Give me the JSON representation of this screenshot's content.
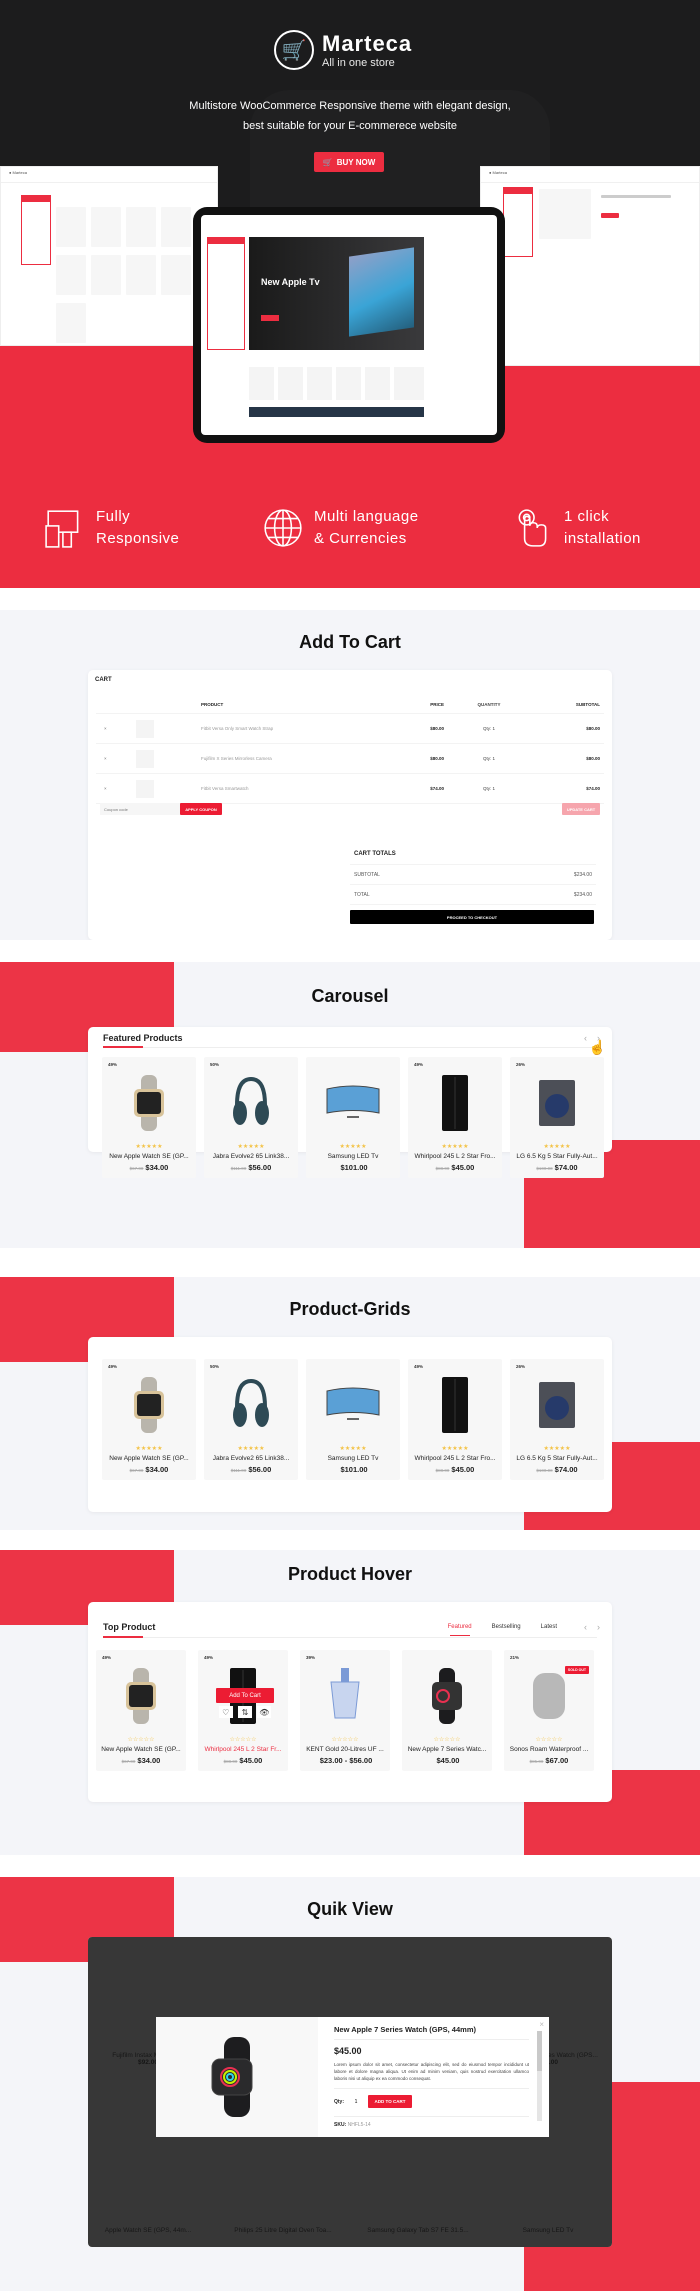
{
  "hero": {
    "brand": "Marteca",
    "tagline": "All in one store",
    "description_line1": "Multistore WooCommerce Responsive theme with elegant design,",
    "description_line2": "best suitable for your E-commerece website",
    "buy_label": "BUY NOW",
    "tablet_banner_title": "New Apple Tv",
    "accent_color": "#ec2d40",
    "features": [
      {
        "icon": "responsive-devices-icon",
        "line1": "Fully",
        "line2": "Responsive"
      },
      {
        "icon": "globe-icon",
        "line1": "Multi language",
        "line2": "& Currencies"
      },
      {
        "icon": "tap-finger-icon",
        "line1": "1 click",
        "line2": "installation"
      }
    ]
  },
  "cart_section": {
    "heading": "Add To Cart",
    "cart_label": "CART",
    "columns": [
      "PRODUCT",
      "PRICE",
      "QUANTITY",
      "SUBTOTAL"
    ],
    "rows": [
      {
        "name": "Fitbit Versa Only Smart Watch Strap",
        "price": "$80.00",
        "qty_label": "Qty:",
        "qty": "1",
        "subtotal": "$80.00"
      },
      {
        "name": "Fujifilm X Series Mirrorless Camera",
        "price": "$80.00",
        "qty_label": "Qty:",
        "qty": "1",
        "subtotal": "$80.00"
      },
      {
        "name": "Fitbit Versa Smartwatch",
        "price": "$74.00",
        "qty_label": "Qty:",
        "qty": "1",
        "subtotal": "$74.00"
      }
    ],
    "coupon_placeholder": "Coupon code",
    "apply_coupon": "APPLY COUPON",
    "update_cart": "UPDATE CART",
    "totals_title": "CART TOTALS",
    "subtotal_label": "SUBTOTAL",
    "subtotal_value": "$234.00",
    "total_label": "TOTAL",
    "total_value": "$234.00",
    "checkout": "PROCEED TO CHECKOUT"
  },
  "carousel_section": {
    "heading": "Carousel",
    "title": "Featured Products",
    "products": [
      {
        "discount": "49%",
        "name": "New Apple Watch SE (GP...",
        "old_price": "$67.00",
        "price": "$34.00",
        "stars": "★★★★★"
      },
      {
        "discount": "50%",
        "name": "Jabra Evolve2 65 Link38...",
        "old_price": "$111.00",
        "price": "$56.00",
        "stars": "★★★★★"
      },
      {
        "discount": "",
        "name": "Samsung LED Tv",
        "old_price": "",
        "price": "$101.00",
        "stars": "★★★★★"
      },
      {
        "discount": "49%",
        "name": "Whirlpool 245 L 2 Star Fro...",
        "old_price": "$88.00",
        "price": "$45.00",
        "stars": "★★★★★"
      },
      {
        "discount": "26%",
        "name": "LG 6.5 Kg 5 Star Fully-Aut...",
        "old_price": "$100.00",
        "price": "$74.00",
        "stars": "★★★★★"
      }
    ]
  },
  "grid_section": {
    "heading": "Product-Grids",
    "products": [
      {
        "discount": "49%",
        "name": "New Apple Watch SE (GP...",
        "old_price": "$67.00",
        "price": "$34.00",
        "stars": "★★★★★"
      },
      {
        "discount": "50%",
        "name": "Jabra Evolve2 65 Link38...",
        "old_price": "$111.00",
        "price": "$56.00",
        "stars": "★★★★★"
      },
      {
        "discount": "",
        "name": "Samsung LED Tv",
        "old_price": "",
        "price": "$101.00",
        "stars": "★★★★★"
      },
      {
        "discount": "49%",
        "name": "Whirlpool 245 L 2 Star Fro...",
        "old_price": "$88.00",
        "price": "$45.00",
        "stars": "★★★★★"
      },
      {
        "discount": "26%",
        "name": "LG 6.5 Kg 5 Star Fully-Aut...",
        "old_price": "$100.00",
        "price": "$74.00",
        "stars": "★★★★★"
      }
    ]
  },
  "hover_section": {
    "heading": "Product Hover",
    "title": "Top Product",
    "tabs": [
      "Featured",
      "Bestselling",
      "Latest"
    ],
    "add_to_cart": "Add To Cart",
    "sold_out": "SOLD OUT",
    "products": [
      {
        "discount": "49%",
        "name": "New Apple Watch SE (GP...",
        "old_price": "$67.00",
        "price": "$34.00",
        "stars": "☆☆☆☆☆"
      },
      {
        "discount": "49%",
        "name": "Whirlpool 245 L 2 Star Fr...",
        "old_price": "$88.00",
        "price": "$45.00",
        "stars": "☆☆☆☆☆"
      },
      {
        "discount": "39%",
        "name": "KENT Gold 20-Litres UF ...",
        "old_price": "",
        "price": "$23.00 - $56.00",
        "stars": "☆☆☆☆☆"
      },
      {
        "discount": "",
        "name": "New Apple 7 Series Watc...",
        "old_price": "",
        "price": "$45.00",
        "stars": "☆☆☆☆☆"
      },
      {
        "discount": "21%",
        "name": "Sonos Roam Waterproof ...",
        "old_price": "$85.00",
        "price": "$67.00",
        "stars": "☆☆☆☆☆"
      }
    ]
  },
  "quickview_section": {
    "heading": "Quik View",
    "background_products": [
      {
        "name": "Fujifilm Instax Mini 9 In...",
        "price": "$92.00"
      },
      {
        "name": "",
        "price": ""
      },
      {
        "name": "",
        "price": ""
      },
      {
        "name": "New Apple 7 Series Watch (GPS...",
        "price": "$45.00"
      },
      {
        "name": "Apple Watch SE (GPS, 44m...",
        "price": ""
      },
      {
        "name": "Philips 25 Litre Digital Oven Toa...",
        "price": ""
      },
      {
        "name": "Samsung Galaxy Tab S7 FE 31.5...",
        "price": ""
      },
      {
        "name": "Samsung LED Tv",
        "price": ""
      }
    ],
    "modal": {
      "name": "New Apple 7 Series Watch (GPS, 44mm)",
      "price": "$45.00",
      "description": "Lorem ipsum dolor sit amet, consectetur adipiscing elit, sed do eiusmod tempor incididunt ut labore et dolore magna aliqua. Ut enim ad minim veniam, quis nostrud exercitation ullamco laboris nisi ut aliquip ex ea commodo consequat.",
      "qty_label": "Qty:",
      "qty": "1",
      "add_to_cart": "ADD TO CART",
      "sku_label": "SKU:",
      "sku": "NHFL5-14",
      "close": "×"
    }
  }
}
